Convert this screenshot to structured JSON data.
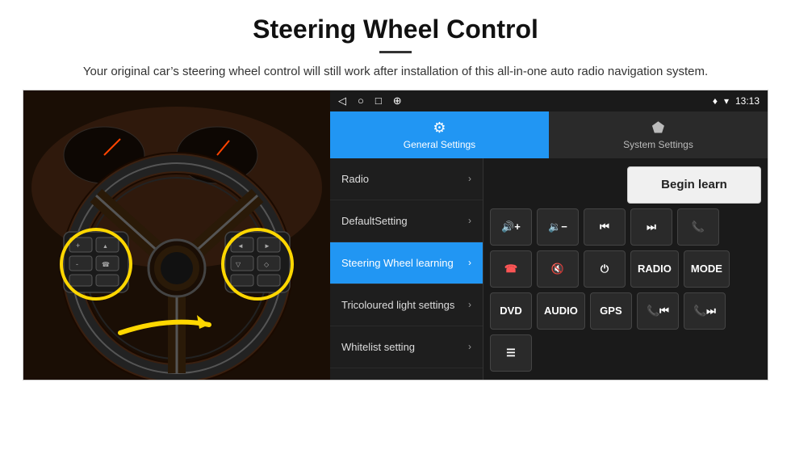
{
  "header": {
    "title": "Steering Wheel Control",
    "subtitle": "Your original car’s steering wheel control will still work after installation of this all-in-one auto radio navigation system."
  },
  "statusBar": {
    "time": "13:13",
    "icons": [
      "◁",
      "○",
      "□",
      "☉"
    ]
  },
  "tabs": [
    {
      "id": "general",
      "label": "General Settings",
      "icon": "⚙",
      "active": true
    },
    {
      "id": "system",
      "label": "System Settings",
      "icon": "⬬",
      "active": false
    }
  ],
  "menu": [
    {
      "id": "radio",
      "label": "Radio",
      "active": false
    },
    {
      "id": "default-setting",
      "label": "DefaultSetting",
      "active": false
    },
    {
      "id": "steering-wheel",
      "label": "Steering Wheel learning",
      "active": true
    },
    {
      "id": "tricoloured",
      "label": "Tricoloured light settings",
      "active": false
    },
    {
      "id": "whitelist",
      "label": "Whitelist setting",
      "active": false
    }
  ],
  "controls": {
    "begin_learn": "Begin learn",
    "row1": [
      {
        "id": "vol-up",
        "icon": "🔊+",
        "symbol": "vol_up"
      },
      {
        "id": "vol-down",
        "icon": "🔉-",
        "symbol": "vol_down"
      },
      {
        "id": "prev",
        "icon": "⏮",
        "symbol": "prev"
      },
      {
        "id": "next",
        "icon": "⏭",
        "symbol": "next"
      },
      {
        "id": "phone",
        "icon": "☎",
        "symbol": "phone"
      }
    ],
    "row2": [
      {
        "id": "hang-up",
        "icon": "✆",
        "symbol": "hang_up"
      },
      {
        "id": "mute",
        "icon": "🔇x",
        "symbol": "mute"
      },
      {
        "id": "power",
        "icon": "⏻",
        "symbol": "power"
      },
      {
        "id": "radio-btn",
        "label": "RADIO",
        "symbol": "radio"
      },
      {
        "id": "mode-btn",
        "label": "MODE",
        "symbol": "mode"
      }
    ],
    "row3": [
      {
        "id": "dvd-btn",
        "label": "DVD",
        "symbol": "dvd"
      },
      {
        "id": "audio-btn",
        "label": "AUDIO",
        "symbol": "audio"
      },
      {
        "id": "gps-btn",
        "label": "GPS",
        "symbol": "gps"
      },
      {
        "id": "tel-prev",
        "icon": "☎preview",
        "symbol": "tel_prev"
      },
      {
        "id": "tel-next",
        "icon": "☎next",
        "symbol": "tel_next"
      }
    ],
    "row4": [
      {
        "id": "list-btn",
        "icon": "☰",
        "symbol": "list"
      }
    ]
  }
}
